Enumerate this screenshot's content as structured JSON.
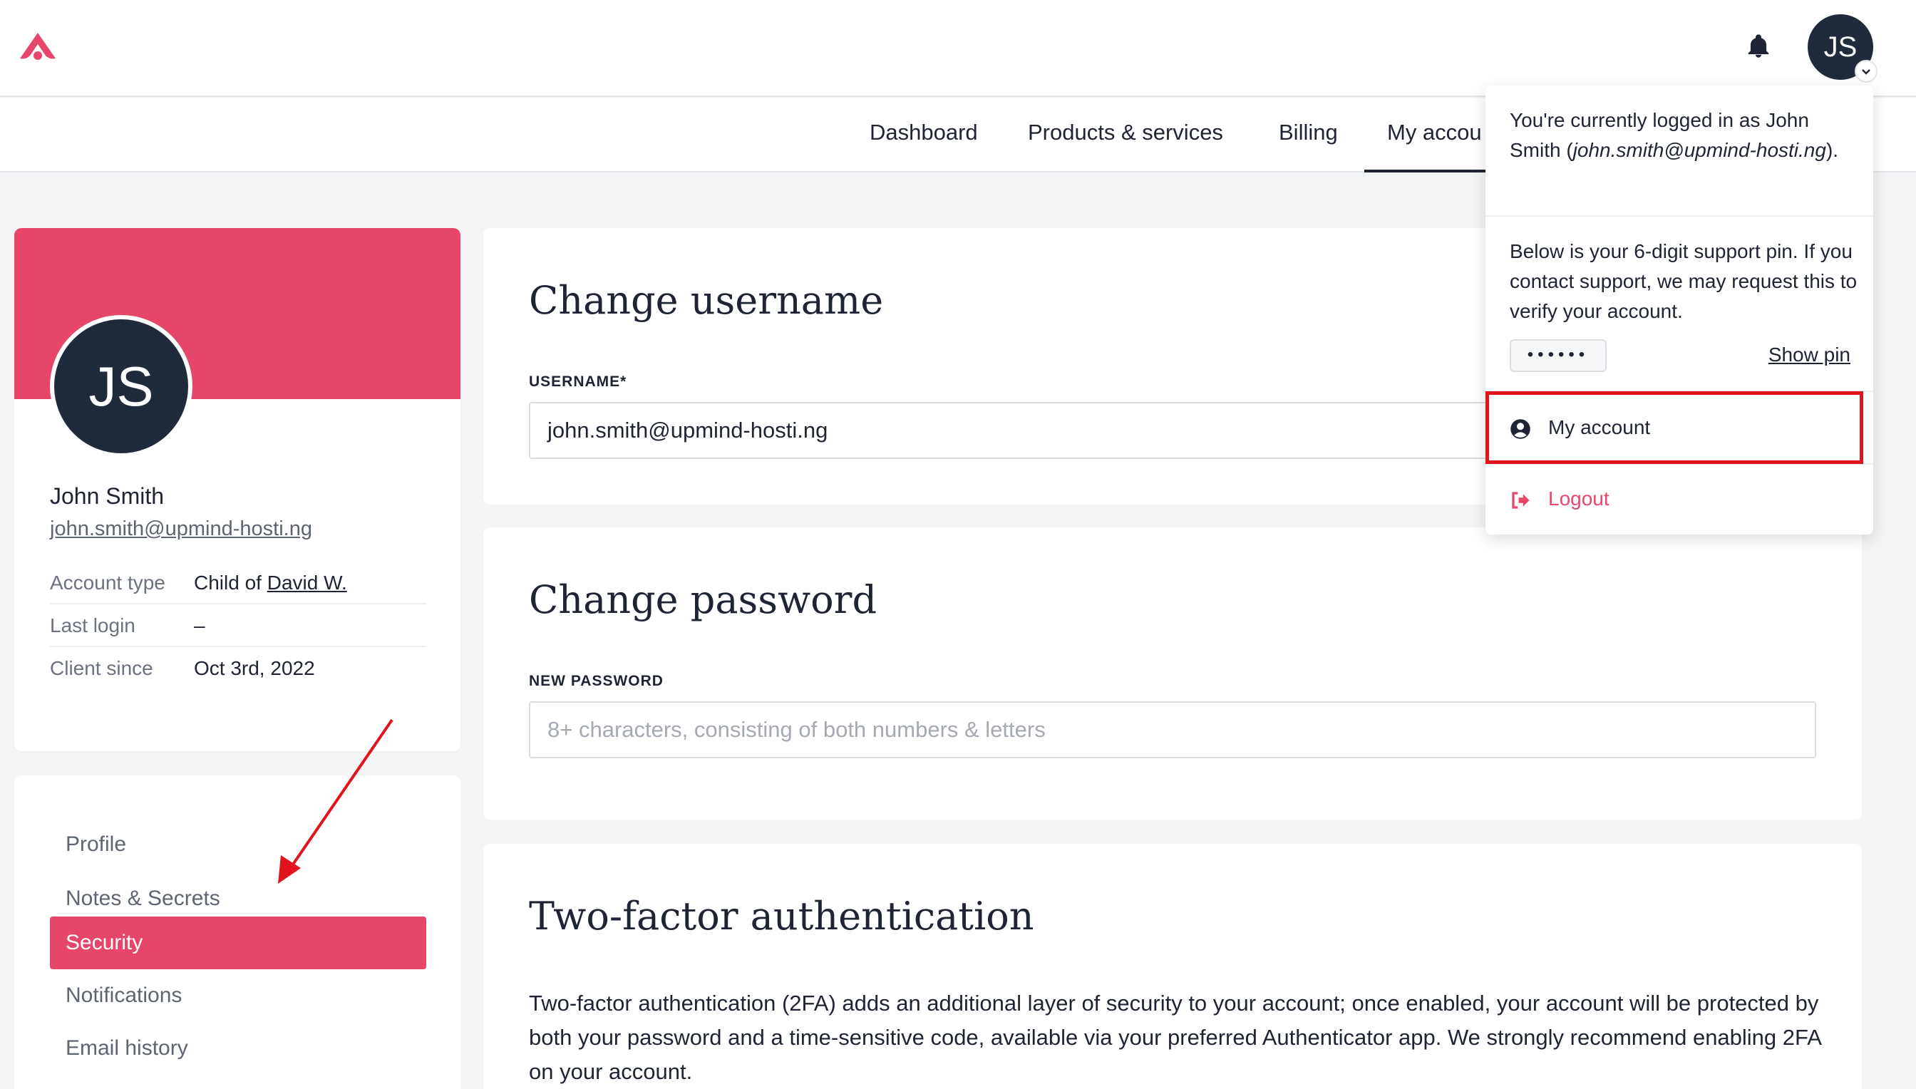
{
  "header": {
    "logo_icon": "brand-logo-icon",
    "bell_icon": "bell-icon",
    "avatar_initials": "JS",
    "brand_color": "#e5466a"
  },
  "nav": {
    "items": [
      {
        "label": "Dashboard"
      },
      {
        "label": "Products & services"
      },
      {
        "label": "Billing"
      },
      {
        "label": "My accou"
      }
    ]
  },
  "profile": {
    "initials": "JS",
    "name": "John Smith",
    "email": "john.smith@upmind-hosti.ng",
    "rows": [
      {
        "key": "Account type",
        "value_prefix": "Child of ",
        "value_link": "David W."
      },
      {
        "key": "Last login",
        "value": "–"
      },
      {
        "key": "Client since",
        "value": "Oct 3rd, 2022"
      }
    ]
  },
  "sidemenu": {
    "items": [
      {
        "label": "Profile"
      },
      {
        "label": "Notes & Secrets"
      },
      {
        "label": "Security"
      },
      {
        "label": "Notifications"
      },
      {
        "label": "Email history"
      }
    ],
    "active": "Security"
  },
  "username_card": {
    "title": "Change username",
    "label": "USERNAME*",
    "value": "john.smith@upmind-hosti.ng"
  },
  "password_card": {
    "title": "Change password",
    "label": "NEW PASSWORD",
    "placeholder": "8+ characters, consisting of both numbers & letters"
  },
  "twofa_card": {
    "title": "Two-factor authentication",
    "text": "Two-factor authentication (2FA) adds an additional layer of security to your account; once enabled, your account will be protected by both your password and a time-sensitive code, available via your preferred Authenticator app. We strongly recommend enabling 2FA on your account."
  },
  "dropdown": {
    "logged_prefix": "You're currently logged in as ",
    "logged_name": "John Smith",
    "logged_email": "john.smith@upmind-hosti.ng",
    "pin_text": "Below is your 6-digit support pin. If you contact support, we may request this to verify your account.",
    "pin_mask": "••••••",
    "show_pin": "Show pin",
    "my_account": "My account",
    "logout": "Logout",
    "logout_color": "#e5466a",
    "highlight_color": "#e1141e"
  }
}
